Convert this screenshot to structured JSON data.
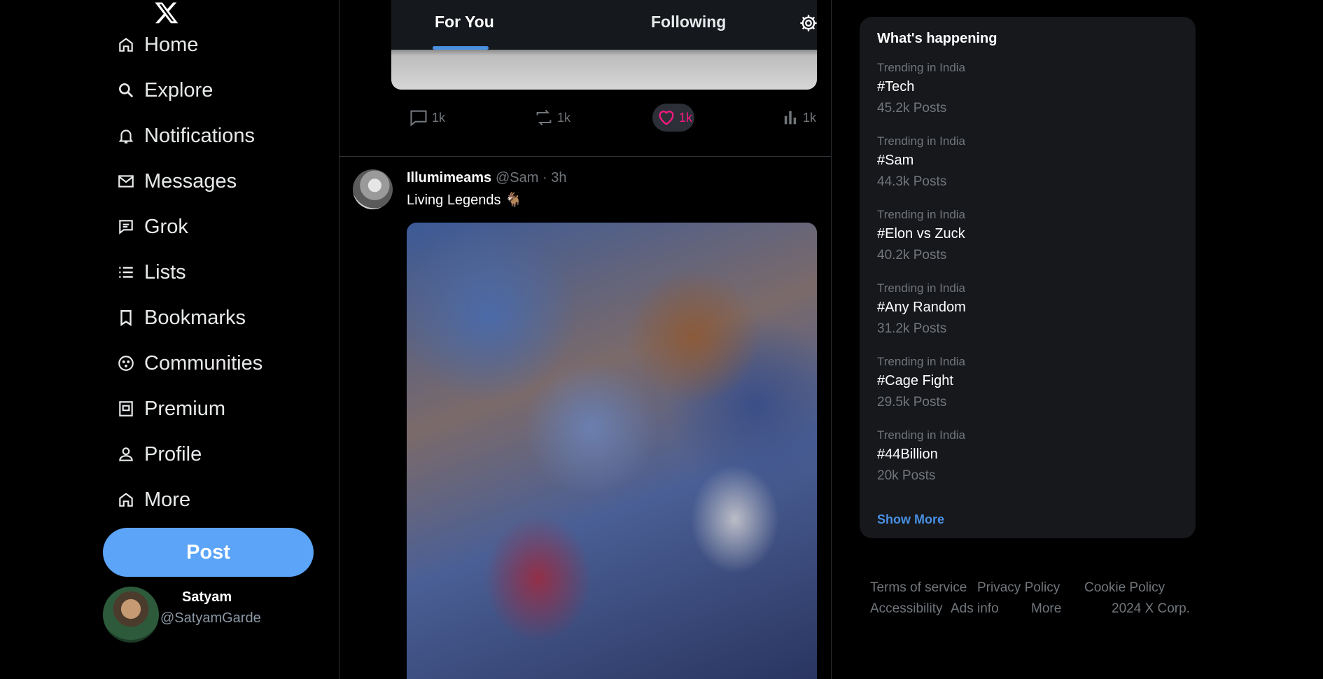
{
  "nav": {
    "items": [
      {
        "label": "Home",
        "icon": "home-icon"
      },
      {
        "label": "Explore",
        "icon": "search-icon"
      },
      {
        "label": "Notifications",
        "icon": "bell-icon"
      },
      {
        "label": "Messages",
        "icon": "mail-icon"
      },
      {
        "label": "Grok",
        "icon": "grok-icon"
      },
      {
        "label": "Lists",
        "icon": "list-icon"
      },
      {
        "label": "Bookmarks",
        "icon": "bookmark-icon"
      },
      {
        "label": "Communities",
        "icon": "communities-icon"
      },
      {
        "label": "Premium",
        "icon": "premium-icon"
      },
      {
        "label": "Profile",
        "icon": "person-icon"
      },
      {
        "label": "More",
        "icon": "home-icon"
      }
    ],
    "post_button": "Post"
  },
  "user": {
    "name": "Satyam",
    "handle": "@SatyamGarde"
  },
  "tabs": {
    "for_you": "For You",
    "following": "Following"
  },
  "prev_post": {
    "actions": {
      "reply": "1k",
      "repost": "1k",
      "like": "1k",
      "views": "1k"
    }
  },
  "post": {
    "author": "Illumimeams",
    "meta": "@Sam · 3h",
    "text": "Living Legends 🐐"
  },
  "trending": {
    "heading": "What's happening",
    "items": [
      {
        "context": "Trending in India",
        "tag": "#Tech",
        "count": "45.2k Posts"
      },
      {
        "context": "Trending in India",
        "tag": "#Sam",
        "count": "44.3k Posts"
      },
      {
        "context": "Trending in India",
        "tag": "#Elon vs Zuck",
        "count": "40.2k Posts"
      },
      {
        "context": "Trending in India",
        "tag": "#Any Random",
        "count": "31.2k Posts"
      },
      {
        "context": "Trending in India",
        "tag": "#Cage Fight",
        "count": "29.5k Posts"
      },
      {
        "context": "Trending in India",
        "tag": "#44Billion",
        "count": "20k Posts"
      }
    ],
    "show_more": "Show More"
  },
  "footer": {
    "terms": "Terms of service",
    "privacy": "Privacy Policy",
    "cookie": "Cookie Policy",
    "accessibility": "Accessibility",
    "ads": "Ads info",
    "more": "More",
    "copyright": "2024 X Corp."
  },
  "colors": {
    "accent": "#4a90e2",
    "post_button": "#5ba4f8",
    "like": "#f91880",
    "panel": "#16181c"
  }
}
